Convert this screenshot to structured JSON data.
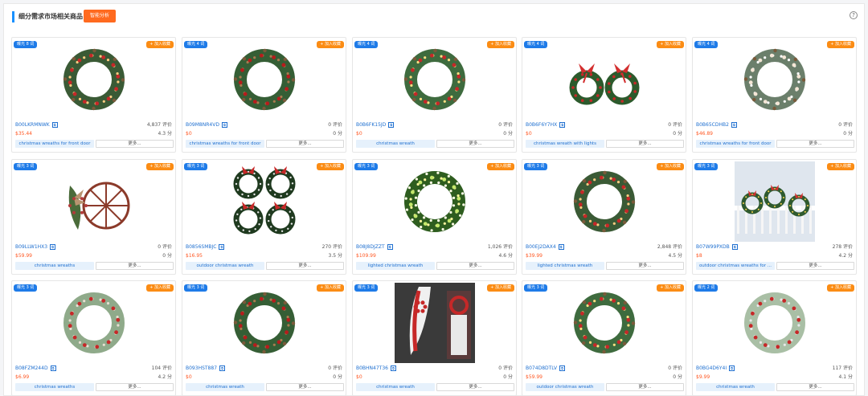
{
  "header": {
    "title": "细分需求市场相关商品",
    "button_label": "智能分析",
    "help_glyph": "?"
  },
  "accent_color": "#1890ff",
  "products": [
    {
      "exp": "曝光 8 词",
      "add": "+ 加入收藏",
      "asin": "B00LKRMNWK",
      "reviews": "4,837 评价",
      "price": "$35.44",
      "rating": "4.3 分",
      "keyword": "christmas wreaths for front door",
      "more": "更多...",
      "img": "wreath",
      "variant": "full"
    },
    {
      "exp": "曝光 4 词",
      "add": "+ 加入收藏",
      "asin": "B09M8NR4VD",
      "reviews": "0 评价",
      "price": "$0",
      "rating": "0 分",
      "keyword": "christmas wreaths for front door",
      "more": "更多...",
      "img": "wreath",
      "variant": "sparse"
    },
    {
      "exp": "曝光 4 词",
      "add": "+ 加入收藏",
      "asin": "B0B6FK15JD",
      "reviews": "0 评价",
      "price": "$0",
      "rating": "0 分",
      "keyword": "christmas wreath",
      "more": "更多...",
      "img": "wreath",
      "variant": "lights"
    },
    {
      "exp": "曝光 4 词",
      "add": "+ 加入收藏",
      "asin": "B0B6F6Y7HX",
      "reviews": "0 评价",
      "price": "$0",
      "rating": "0 分",
      "keyword": "christmas wreath with lights",
      "more": "更多...",
      "img": "twin-bows",
      "variant": "twin"
    },
    {
      "exp": "曝光 4 词",
      "add": "+ 加入收藏",
      "asin": "B0B65CDHB2",
      "reviews": "0 评价",
      "price": "$46.89",
      "rating": "0 分",
      "keyword": "christmas wreaths for front door",
      "more": "更多...",
      "img": "wreath",
      "variant": "white"
    },
    {
      "exp": "曝光 3 词",
      "add": "+ 加入收藏",
      "asin": "B09LLW1HX3",
      "reviews": "0 评价",
      "price": "$59.99",
      "rating": "0 分",
      "keyword": "christmas wreaths",
      "more": "更多...",
      "img": "wagon-wheel",
      "variant": "wheel"
    },
    {
      "exp": "曝光 3 词",
      "add": "+ 加入收藏",
      "asin": "B0856SMBJC",
      "reviews": "270 评价",
      "price": "$16.95",
      "rating": "3.5 分",
      "keyword": "outdoor christmas wreath",
      "more": "更多...",
      "img": "four-wreaths",
      "variant": "quad"
    },
    {
      "exp": "曝光 3 词",
      "add": "+ 加入收藏",
      "asin": "B08J8DJZZT",
      "reviews": "1,026 评价",
      "price": "$109.99",
      "rating": "4.6 分",
      "keyword": "lighted christmas wreath",
      "more": "更多...",
      "img": "wreath",
      "variant": "glow"
    },
    {
      "exp": "曝光 3 词",
      "add": "+ 加入收藏",
      "asin": "B00EJ2DAX4",
      "reviews": "2,848 评价",
      "price": "$39.99",
      "rating": "4.5 分",
      "keyword": "lighted christmas wreath",
      "more": "更多...",
      "img": "wreath",
      "variant": "full"
    },
    {
      "exp": "曝光 3 词",
      "add": "+ 加入收藏",
      "asin": "B07W99PXDB",
      "reviews": "278 评价",
      "price": "$8",
      "rating": "4.2 分",
      "keyword": "outdoor christmas wreaths for ...",
      "more": "更多...",
      "img": "porch-wreaths",
      "variant": "porch"
    },
    {
      "exp": "曝光 3 词",
      "add": "+ 加入收藏",
      "asin": "B08FZM244D",
      "reviews": "104 评价",
      "price": "$6.99",
      "rating": "4.2 分",
      "keyword": "christmas wreaths",
      "more": "更多...",
      "img": "wreath",
      "variant": "eucalyptus"
    },
    {
      "exp": "曝光 3 词",
      "add": "+ 加入收藏",
      "asin": "B093HST887",
      "reviews": "0 评价",
      "price": "$0",
      "rating": "0 分",
      "keyword": "christmas wreath",
      "more": "更多...",
      "img": "wreath",
      "variant": "sparse"
    },
    {
      "exp": "曝光 3 词",
      "add": "+ 加入收藏",
      "asin": "B0BHN47T36",
      "reviews": "0 评价",
      "price": "$0",
      "rating": "0 分",
      "keyword": "christmas wreath",
      "more": "更多...",
      "img": "swag",
      "variant": "swag"
    },
    {
      "exp": "曝光 3 词",
      "add": "+ 加入收藏",
      "asin": "B074D8DTLV",
      "reviews": "0 评价",
      "price": "$59.99",
      "rating": "0 分",
      "keyword": "outdoor christmas wreath",
      "more": "更多...",
      "img": "wreath",
      "variant": "lights"
    },
    {
      "exp": "曝光 2 词",
      "add": "+ 加入收藏",
      "asin": "B0BG4D6Y4I",
      "reviews": "117 评价",
      "price": "$9.99",
      "rating": "4.1 分",
      "keyword": "christmas wreath",
      "more": "更多...",
      "img": "wreath",
      "variant": "berry"
    }
  ]
}
